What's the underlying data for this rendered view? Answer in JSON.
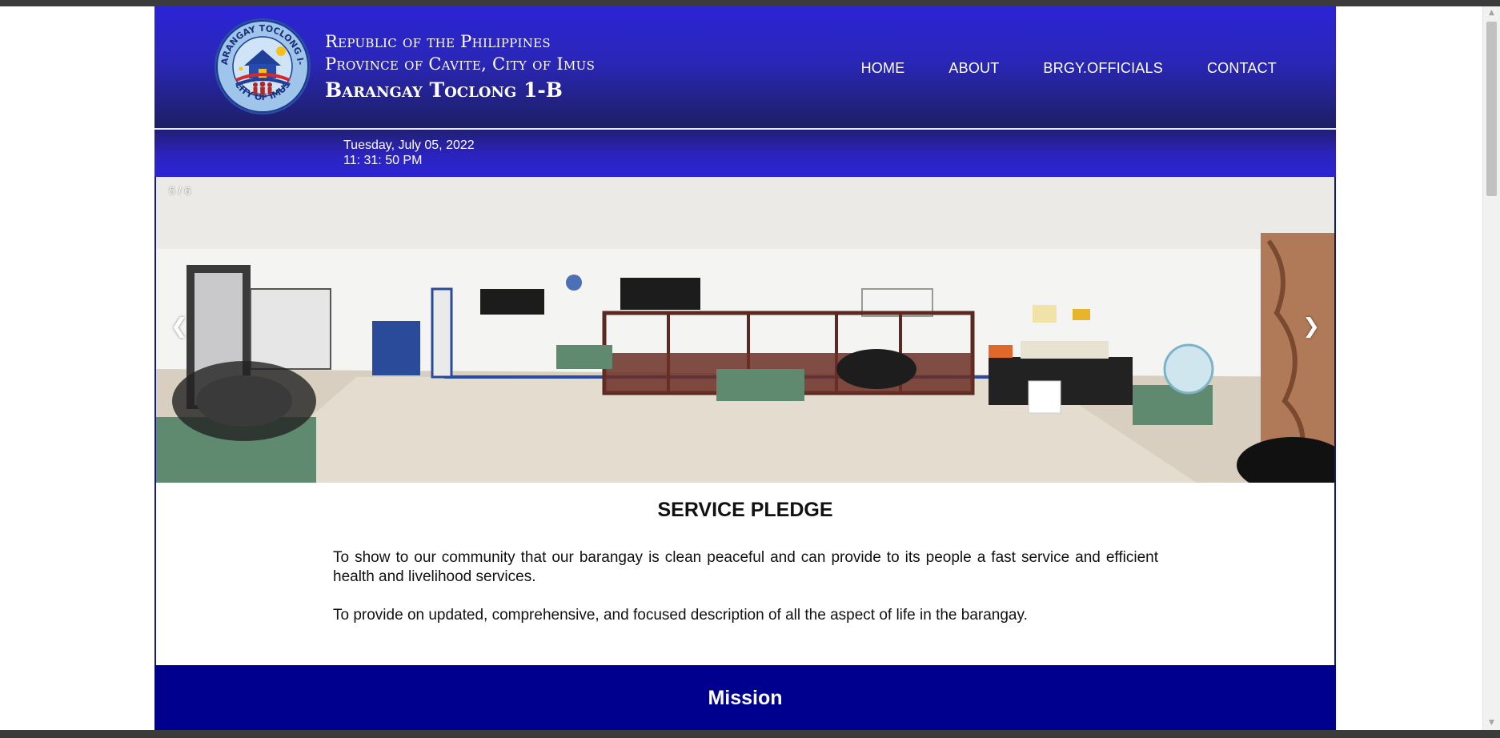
{
  "header": {
    "line1": "Republic of the Philippines",
    "line2": "Province of Cavite, City of Imus",
    "line3": "Barangay Toclong 1-B",
    "logo_text_top": "BARANGAY TOCLONG I-B",
    "logo_text_bottom": "CITY OF IMUS"
  },
  "nav": {
    "items": [
      "HOME",
      "ABOUT",
      "BRGY.OFFICIALS",
      "CONTACT"
    ]
  },
  "datetime": {
    "date": "Tuesday, July 05, 2022",
    "time": "11: 31: 50 PM"
  },
  "slideshow": {
    "counter": "5 / 6",
    "prev_icon": "❮",
    "next_icon": "❯"
  },
  "pledge": {
    "title": "SERVICE PLEDGE",
    "paragraphs": [
      "To show to our community that our barangay is clean peaceful and can provide to its people a fast service and efficient health and livelihood services.",
      "To provide on updated, comprehensive, and focused description of all the aspect of life in the barangay."
    ]
  },
  "mission": {
    "title": "Mission"
  },
  "colors": {
    "header_top": "#2b24d6",
    "header_bottom": "#1d1f63",
    "mission_bg": "#00008f"
  }
}
